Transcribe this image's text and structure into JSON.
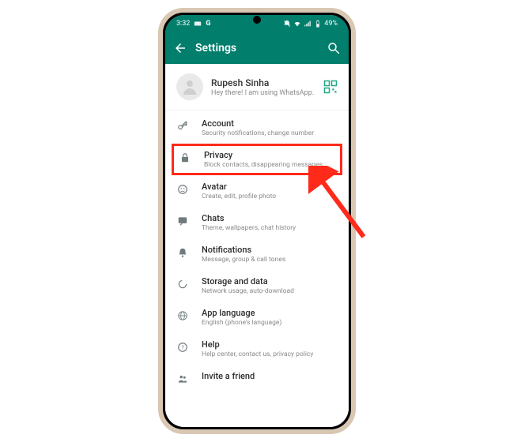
{
  "statusbar": {
    "time": "3:32",
    "battery": "49%"
  },
  "appbar": {
    "title": "Settings"
  },
  "profile": {
    "name": "Rupesh Sinha",
    "status": "Hey there! I am using WhatsApp."
  },
  "rows": {
    "account": {
      "title": "Account",
      "sub": "Security notifications, change number"
    },
    "privacy": {
      "title": "Privacy",
      "sub": "Block contacts, disappearing messages"
    },
    "avatar": {
      "title": "Avatar",
      "sub": "Create, edit, profile photo"
    },
    "chats": {
      "title": "Chats",
      "sub": "Theme, wallpapers, chat history"
    },
    "notifications": {
      "title": "Notifications",
      "sub": "Message, group & call tones"
    },
    "storage": {
      "title": "Storage and data",
      "sub": "Network usage, auto-download"
    },
    "language": {
      "title": "App language",
      "sub": "English (phone's language)"
    },
    "help": {
      "title": "Help",
      "sub": "Help center, contact us, privacy policy"
    },
    "invite": {
      "title": "Invite a friend",
      "sub": ""
    }
  }
}
